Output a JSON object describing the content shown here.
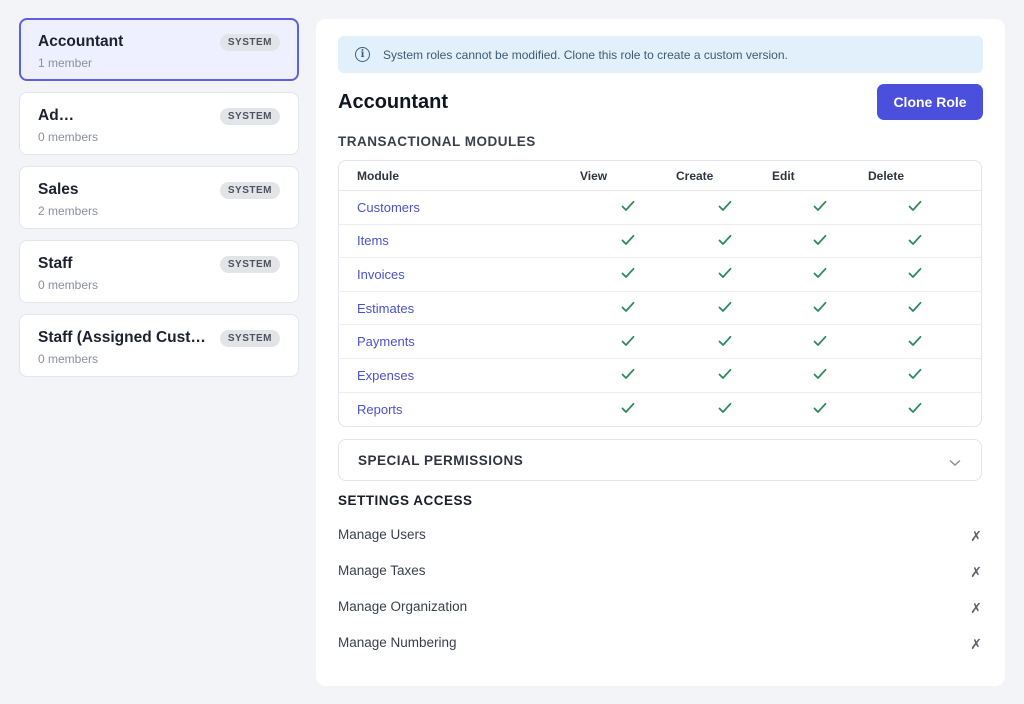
{
  "roles": [
    {
      "name": "Accountant",
      "members": "1 member",
      "badge": "SYSTEM"
    },
    {
      "name": "Ad…",
      "members": "0 members",
      "badge": "SYSTEM"
    },
    {
      "name": "Sales",
      "members": "2 members",
      "badge": "SYSTEM"
    },
    {
      "name": "Staff",
      "members": "0 members",
      "badge": "SYSTEM"
    },
    {
      "name": "Staff (Assigned Cust…",
      "members": "0 members",
      "badge": "SYSTEM"
    }
  ],
  "notice": {
    "icon": "info-icon",
    "text": "System roles cannot be modified. Clone this role to create a custom version."
  },
  "page": {
    "title": "Accountant",
    "clone_label": "Clone Role"
  },
  "modules": {
    "heading": "TRANSACTIONAL MODULES",
    "columns": [
      "Module",
      "View",
      "Create",
      "Edit",
      "Delete"
    ],
    "rows": [
      {
        "name": "Customers",
        "view": true,
        "create": true,
        "edit": true,
        "delete": true
      },
      {
        "name": "Items",
        "view": true,
        "create": true,
        "edit": true,
        "delete": true
      },
      {
        "name": "Invoices",
        "view": true,
        "create": true,
        "edit": true,
        "delete": true
      },
      {
        "name": "Estimates",
        "view": true,
        "create": true,
        "edit": true,
        "delete": true
      },
      {
        "name": "Payments",
        "view": true,
        "create": true,
        "edit": true,
        "delete": true
      },
      {
        "name": "Expenses",
        "view": true,
        "create": true,
        "edit": true,
        "delete": true
      },
      {
        "name": "Reports",
        "view": true,
        "create": true,
        "edit": true,
        "delete": true
      }
    ]
  },
  "special": {
    "label": "SPECIAL PERMISSIONS",
    "icon": "chevron-down-icon"
  },
  "settings": {
    "heading": "SETTINGS ACCESS",
    "items": [
      {
        "label": "Manage Users",
        "mark": "✗"
      },
      {
        "label": "Manage Taxes",
        "mark": "✗"
      },
      {
        "label": "Manage Organization",
        "mark": "✗"
      },
      {
        "label": "Manage Numbering",
        "mark": "✗"
      }
    ]
  },
  "colors": {
    "accent": "#4a4fdc",
    "check": "#2e8a5e",
    "link": "#4a52c9",
    "notice_bg": "#e2f0fb"
  }
}
